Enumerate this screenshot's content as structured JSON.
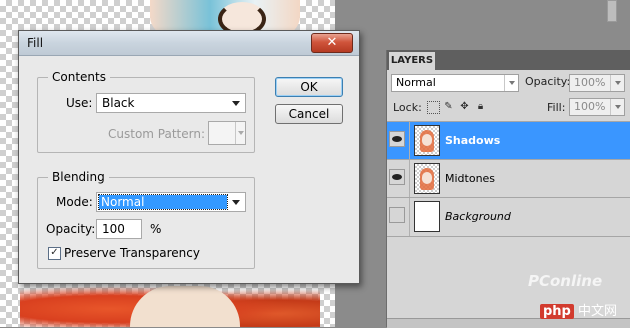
{
  "dialog": {
    "title": "Fill",
    "close_glyph": "✕",
    "contents": {
      "legend": "Contents",
      "use_label": "Use:",
      "use_value": "Black",
      "custom_pattern_label": "Custom Pattern:"
    },
    "blending": {
      "legend": "Blending",
      "mode_label": "Mode:",
      "mode_value": "Normal",
      "opacity_label": "Opacity:",
      "opacity_value": "100",
      "opacity_unit": "%",
      "preserve_label": "Preserve Transparency",
      "preserve_checked": true
    },
    "ok_label": "OK",
    "cancel_label": "Cancel"
  },
  "layers": {
    "tab_label": "LAYERS",
    "blend_mode": "Normal",
    "opacity_label": "Opacity:",
    "opacity_value": "100%",
    "lock_label": "Lock:",
    "fill_label": "Fill:",
    "fill_value": "100%",
    "items": [
      {
        "name": "Shadows",
        "visible": true,
        "selected": true
      },
      {
        "name": "Midtones",
        "visible": true,
        "selected": false
      },
      {
        "name": "Background",
        "visible": false,
        "selected": false
      }
    ]
  },
  "watermark": {
    "brand": "PConline",
    "badge": "php",
    "site": "中文网"
  },
  "colors": {
    "selection": "#3a96ff",
    "dialog_bg": "#e9e9e9",
    "close_red": "#d0553c"
  }
}
